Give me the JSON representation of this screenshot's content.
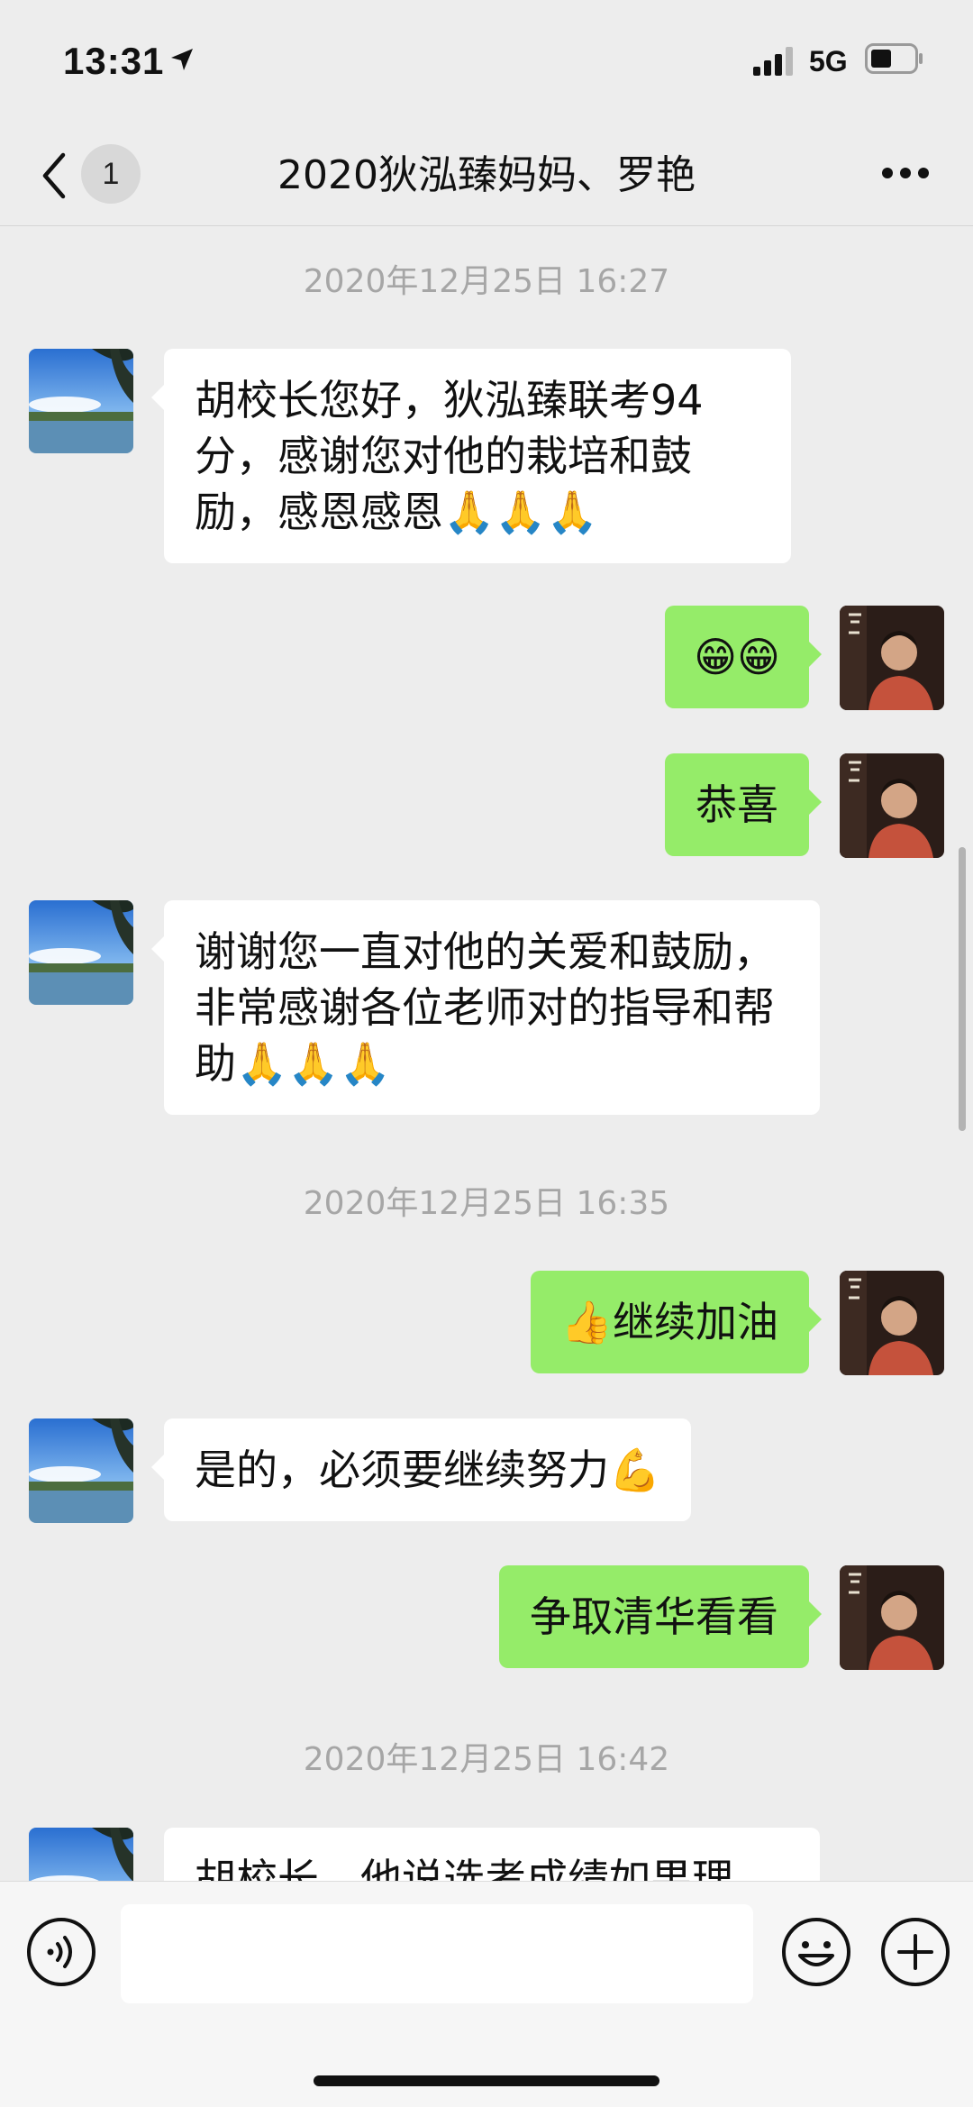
{
  "status_bar": {
    "time": "13:31",
    "network": "5G"
  },
  "nav": {
    "unread_count": "1",
    "title": "2020狄泓臻妈妈、罗艳"
  },
  "messages": [
    {
      "type": "timestamp",
      "text": "2020年12月25日 16:27"
    },
    {
      "type": "in",
      "text": "胡校长您好，狄泓臻联考94分，感谢您对他的栽培和鼓励，感恩感恩🙏🙏🙏"
    },
    {
      "type": "out",
      "text": "😁😁"
    },
    {
      "type": "out",
      "text": "恭喜"
    },
    {
      "type": "in",
      "text": "谢谢您一直对他的关爱和鼓励，非常感谢各位老师对的指导和帮助🙏🙏🙏"
    },
    {
      "type": "timestamp",
      "text": "2020年12月25日 16:35"
    },
    {
      "type": "out",
      "text": "👍继续加油"
    },
    {
      "type": "in",
      "text": "是的，必须要继续努力💪"
    },
    {
      "type": "out",
      "text": "争取清华看看"
    },
    {
      "type": "timestamp",
      "text": "2020年12月25日 16:42"
    },
    {
      "type": "in",
      "text": "胡校长，他说选考成绩如果理"
    }
  ],
  "input": {
    "value": ""
  },
  "colors": {
    "background": "#ededed",
    "outgoing_bubble": "#95ec69",
    "incoming_bubble": "#ffffff",
    "timestamp": "#a6a6a6"
  }
}
